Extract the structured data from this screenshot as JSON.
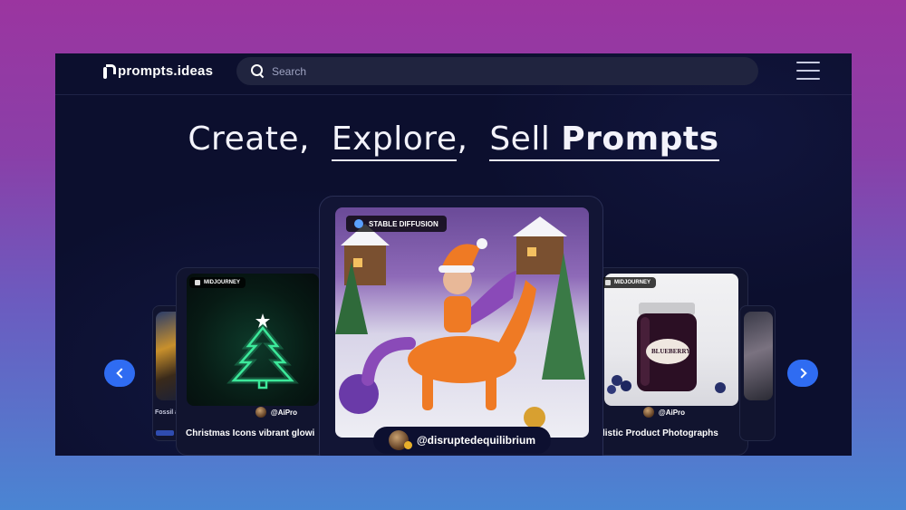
{
  "header": {
    "logo_text": "prompts.ideas",
    "search_placeholder": "Search"
  },
  "hero": {
    "word1": "Create,",
    "word2": "Explore",
    "sep": ",",
    "word3": "Sell",
    "word4": "Prompts"
  },
  "cards": {
    "far_left": {
      "title": "Fossil a"
    },
    "left": {
      "model": "MIDJOURNEY",
      "author": "@AiPro",
      "title": "Christmas Icons vibrant glowi"
    },
    "center": {
      "model": "STABLE DIFFUSION",
      "author": "@disruptedequilibrium"
    },
    "right": {
      "model": "MIDJOURNEY",
      "author": "@AiPro",
      "title": "listic Product Photographs",
      "jar_label": "BLUEBERRY"
    }
  },
  "colors": {
    "accent": "#2f6cf2",
    "background": "#0c0f2e",
    "outer_top": "#9b35a0",
    "outer_bottom": "#4a85d3"
  },
  "icons": {
    "search": "search-icon",
    "menu": "hamburger-menu-icon",
    "prev": "chevron-left-icon",
    "next": "chevron-right-icon"
  }
}
